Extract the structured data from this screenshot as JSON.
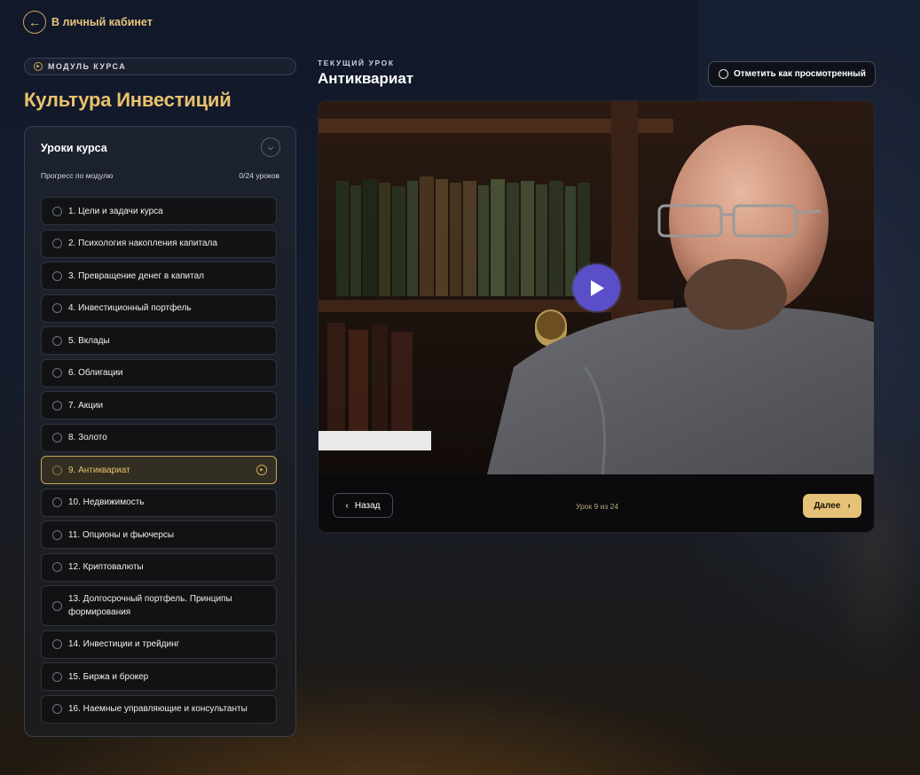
{
  "nav": {
    "back_label": "В личный кабинет"
  },
  "module": {
    "badge": "МОДУЛЬ КУРСА",
    "title": "Культура Инвестиций"
  },
  "lessons_panel": {
    "title": "Уроки курса",
    "progress_label": "Прогресс по модулю",
    "progress_value": "0/24 уроков",
    "lessons": [
      {
        "label": "1. Цели и задачи курса"
      },
      {
        "label": "2. Психология накопления капитала"
      },
      {
        "label": "3. Превращение денег в капитал"
      },
      {
        "label": "4. Инвестиционный портфель"
      },
      {
        "label": "5. Вклады"
      },
      {
        "label": "6. Облигации"
      },
      {
        "label": "7. Акции"
      },
      {
        "label": "8. Золото"
      },
      {
        "label": "9. Антиквариат"
      },
      {
        "label": "10. Недвижимость"
      },
      {
        "label": "11. Опционы и фьючерсы"
      },
      {
        "label": "12. Криптовалюты"
      },
      {
        "label": "13. Долгосрочный портфель. Принципы формирования"
      },
      {
        "label": "14. Инвестиции и трейдинг"
      },
      {
        "label": "15. Биржа и брокер"
      },
      {
        "label": "16. Наемные управляющие и консультанты"
      }
    ]
  },
  "current_lesson": {
    "label": "ТЕКУЩИЙ УРОК",
    "title": "Антиквариат",
    "mark_watched_label": "Отметить как просмотренный"
  },
  "video": {
    "back_label": "Назад",
    "counter": "Урок 9 из 24",
    "next_label": "Далее"
  },
  "colors": {
    "accent_gold": "#e9c16e",
    "play_button": "#5b4fc9",
    "next_button": "#e5c278"
  }
}
